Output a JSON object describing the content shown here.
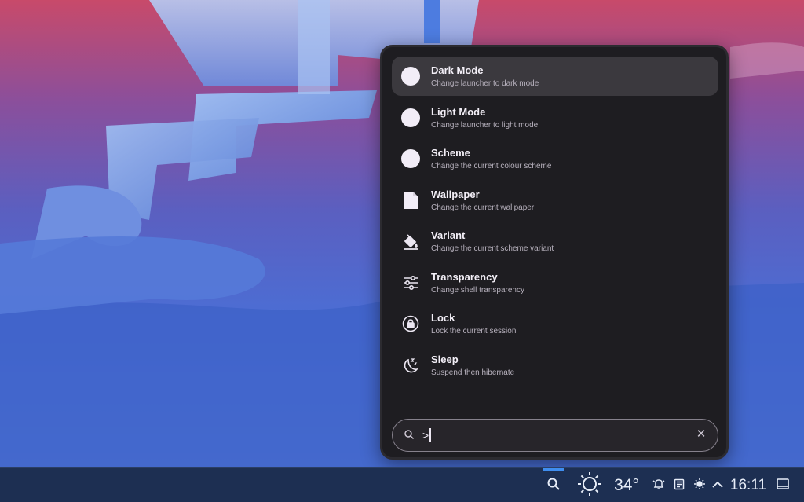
{
  "launcher": {
    "results": [
      {
        "title": "Dark Mode",
        "description": "Change launcher to dark mode",
        "icon": "circle-icon",
        "selected": true
      },
      {
        "title": "Light Mode",
        "description": "Change launcher to light mode",
        "icon": "circle-icon",
        "selected": false
      },
      {
        "title": "Scheme",
        "description": "Change the current colour scheme",
        "icon": "circle-icon",
        "selected": false
      },
      {
        "title": "Wallpaper",
        "description": "Change the current wallpaper",
        "icon": "file-icon",
        "selected": false
      },
      {
        "title": "Variant",
        "description": "Change the current scheme variant",
        "icon": "paint-bucket-icon",
        "selected": false
      },
      {
        "title": "Transparency",
        "description": "Change shell transparency",
        "icon": "sliders-icon",
        "selected": false
      },
      {
        "title": "Lock",
        "description": "Lock the current session",
        "icon": "lock-icon",
        "selected": false
      },
      {
        "title": "Sleep",
        "description": "Suspend then hibernate",
        "icon": "moon-sleep-icon",
        "selected": false
      }
    ],
    "search": {
      "query": ">",
      "search_icon": "search-icon",
      "clear_icon": "close-icon"
    }
  },
  "taskbar": {
    "search_icon": "search-icon",
    "weather_icon": "sun-icon",
    "temperature": "34°",
    "notifications_icon": "bell-icon",
    "clipboard_icon": "clipboard-icon",
    "brightness_icon": "brightness-icon",
    "tray_icon": "chevron-up-icon",
    "clock": "16:11",
    "show_desktop_icon": "desktop-icon"
  },
  "colors": {
    "panel_bg": "#1e1d21",
    "selected_bg": "#3b393e",
    "taskbar_bg": "#1d2f52",
    "accent": "#3f8ef0"
  }
}
